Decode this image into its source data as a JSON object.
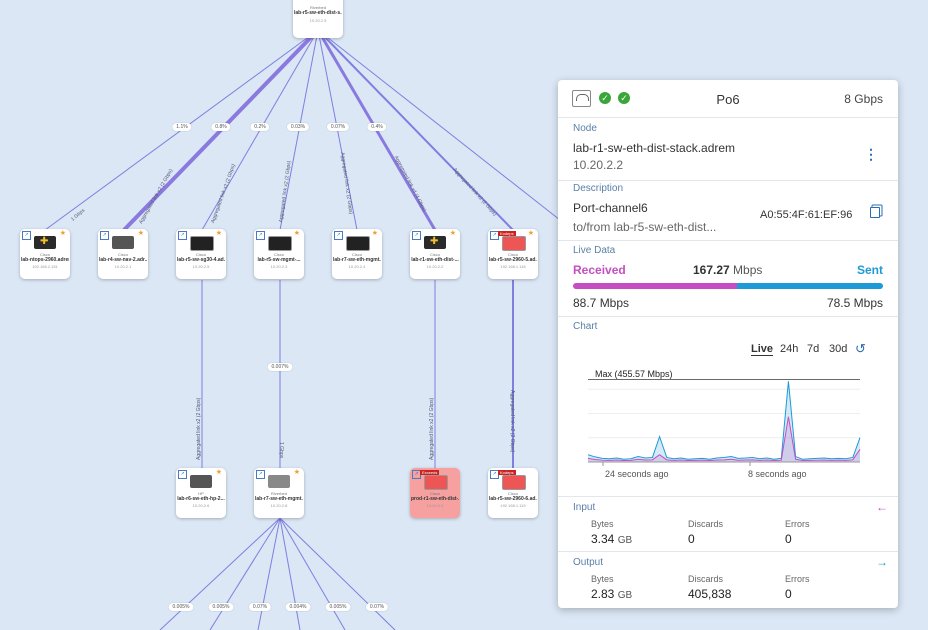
{
  "map": {
    "top_node": {
      "vendor": "Riverbed",
      "name": "lab-r5-sw-eth-dist-s...",
      "ip": "10.20.2.5"
    },
    "edge_labels": [
      "1.1%",
      "0.8%",
      "0.2%",
      "0.03%",
      "0.07%",
      "0.4%",
      "0.007%",
      "0.005%",
      "0.005%",
      "0.07%",
      "0.004%",
      "0.005%",
      "0.07%"
    ],
    "vertical_labels": [
      "1 Gbps",
      "Aggregated link x2 (2 Gbps)",
      "Aggregated link x2 (2 Gbps)",
      "Aggregated link x2 (2 Gbps)",
      "Aggregated link x2 (2 Gbps)",
      "Aggregated link x4 (4 Gbps)",
      "Aggregated link x2 (2 Gbps)",
      "Aggregated link x2 (2 Gbps)",
      "1 Gbps",
      "Aggregated link x2 (2 Gbps)",
      "Aggregated link x2 (2 Gbps)"
    ],
    "row1": [
      {
        "vendor": "Cisco",
        "name": "lab-ntops-2960.adrem",
        "ip": "192.168.2.151"
      },
      {
        "vendor": "Cisco",
        "name": "lab-r4-sw-nav-2.adr...",
        "ip": "10.20.2.1"
      },
      {
        "vendor": "Cisco",
        "name": "lab-r5-sw-sg30-4.ad...",
        "ip": "10.20.2.5"
      },
      {
        "vendor": "Cisco",
        "name": "lab-r5-sw-mgmt-...",
        "ip": "10.20.2.3"
      },
      {
        "vendor": "Cisco",
        "name": "lab-r7-sw-eth-mgmt...",
        "ip": "10.20.2.4"
      },
      {
        "vendor": "Cisco",
        "name": "lab-r1-sw-eth-dist-...",
        "ip": "10.20.2.2"
      },
      {
        "vendor": "Cisco",
        "name": "lab-r5-sw-2960-5.ad...",
        "ip": "192.168.1.118",
        "flag": "Kodeps"
      }
    ],
    "row2": [
      {
        "vendor": "HP",
        "name": "lab-r6-sw-eth-hp-2...",
        "ip": "10.20.2.6"
      },
      {
        "vendor": "Riverbed",
        "name": "lab-r7-sw-eth-mgmt...",
        "ip": "10.20.2.8"
      },
      {
        "vendor": "Cisco",
        "name": "prod-r1-sw-eth-dist-...",
        "ip": "10.20.4.3",
        "flag": "Exceeds"
      },
      {
        "vendor": "Cisco",
        "name": "lab-r5-sw-2960-6.ad...",
        "ip": "192.168.1.119",
        "flag": "Kodeps"
      }
    ]
  },
  "panel": {
    "title": "Po6",
    "speed": "8 Gbps",
    "node": {
      "label": "Node",
      "name": "lab-r1-sw-eth-dist-stack.adrem",
      "ip": "10.20.2.2",
      "menu_icon": "⋮"
    },
    "description": {
      "label": "Description",
      "port": "Port-channel6",
      "peer": "to/from lab-r5-sw-eth-dist...",
      "mac": "A0:55:4F:61:EF:96"
    },
    "live": {
      "label": "Live Data",
      "received": "Received",
      "sent": "Sent",
      "total": "167.27",
      "total_unit": "Mbps",
      "rx": "88.7 Mbps",
      "tx": "78.5 Mbps",
      "rx_fraction": 0.53,
      "rx_color": "#c44ec2",
      "tx_color": "#1e9ad6"
    },
    "chart": {
      "label": "Chart",
      "tabs": [
        "Live",
        "24h",
        "7d",
        "30d"
      ],
      "active_tab": "Live",
      "max_label": "Max (455.57 Mbps)",
      "ticks": [
        "24 seconds ago",
        "8 seconds ago"
      ]
    },
    "input": {
      "label": "Input",
      "bytes_lbl": "Bytes",
      "bytes": "3.34",
      "bytes_unit": "GB",
      "discards_lbl": "Discards",
      "discards": "0",
      "errors_lbl": "Errors",
      "errors": "0",
      "arrow": "←"
    },
    "output": {
      "label": "Output",
      "bytes_lbl": "Bytes",
      "bytes": "2.83",
      "bytes_unit": "GB",
      "discards_lbl": "Discards",
      "discards": "405,838",
      "errors_lbl": "Errors",
      "errors": "0",
      "arrow": "→"
    }
  },
  "chart_data": {
    "type": "area",
    "title": "",
    "xlabel": "",
    "ylabel": "",
    "x_ticks": [
      "24 seconds ago",
      "8 seconds ago"
    ],
    "max_line": 455.57,
    "ylim": [
      0,
      480
    ],
    "series": [
      {
        "name": "Sent",
        "color": "#1e9ad6",
        "values": [
          40,
          28,
          20,
          18,
          22,
          15,
          18,
          30,
          22,
          25,
          140,
          25,
          18,
          22,
          15,
          18,
          20,
          15,
          22,
          25,
          30,
          20,
          22,
          25,
          18,
          22,
          15,
          20,
          445,
          30,
          15,
          18,
          20,
          22,
          18,
          20,
          18,
          25,
          135
        ]
      },
      {
        "name": "Received",
        "color": "#c44ec2",
        "values": [
          20,
          14,
          10,
          9,
          11,
          8,
          9,
          15,
          11,
          12,
          40,
          12,
          9,
          11,
          8,
          9,
          10,
          8,
          11,
          12,
          15,
          10,
          11,
          12,
          9,
          11,
          8,
          10,
          250,
          15,
          8,
          9,
          10,
          11,
          9,
          10,
          9,
          12,
          70
        ]
      }
    ]
  }
}
